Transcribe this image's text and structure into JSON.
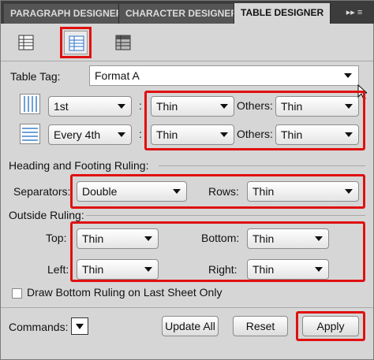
{
  "tabs": [
    {
      "label": "PARAGRAPH DESIGNER"
    },
    {
      "label": "CHARACTER DESIGNER"
    },
    {
      "label": "TABLE DESIGNER"
    }
  ],
  "tab_menu_glyph": "▸▸ ≡",
  "icons": [
    "table-basic-properties-icon",
    "table-ruling-properties-icon",
    "table-shading-properties-icon"
  ],
  "table_tag": {
    "label": "Table Tag:",
    "value": "Format A"
  },
  "column_ruling": {
    "selector": "1st",
    "colon": ":",
    "ruling": "Thin",
    "others_label": "Others:",
    "others": "Thin"
  },
  "row_ruling": {
    "selector": "Every 4th",
    "colon": ":",
    "ruling": "Thin",
    "others_label": "Others:",
    "others": "Thin"
  },
  "heading_footing": {
    "title": "Heading and Footing Ruling:",
    "separators_label": "Separators:",
    "separators": "Double",
    "rows_label": "Rows:",
    "rows": "Thin"
  },
  "outside": {
    "title": "Outside Ruling:",
    "top_label": "Top:",
    "top": "Thin",
    "bottom_label": "Bottom:",
    "bottom": "Thin",
    "left_label": "Left:",
    "left": "Thin",
    "right_label": "Right:",
    "right": "Thin"
  },
  "draw_bottom": {
    "label": "Draw Bottom Ruling on Last Sheet Only",
    "checked": false
  },
  "footer": {
    "commands_label": "Commands:",
    "update_all": "Update All",
    "reset": "Reset",
    "apply": "Apply"
  },
  "colors": {
    "highlight": "#e01010",
    "panel_bg": "#d6d6d6",
    "tab_bar": "#3c3c3c"
  }
}
